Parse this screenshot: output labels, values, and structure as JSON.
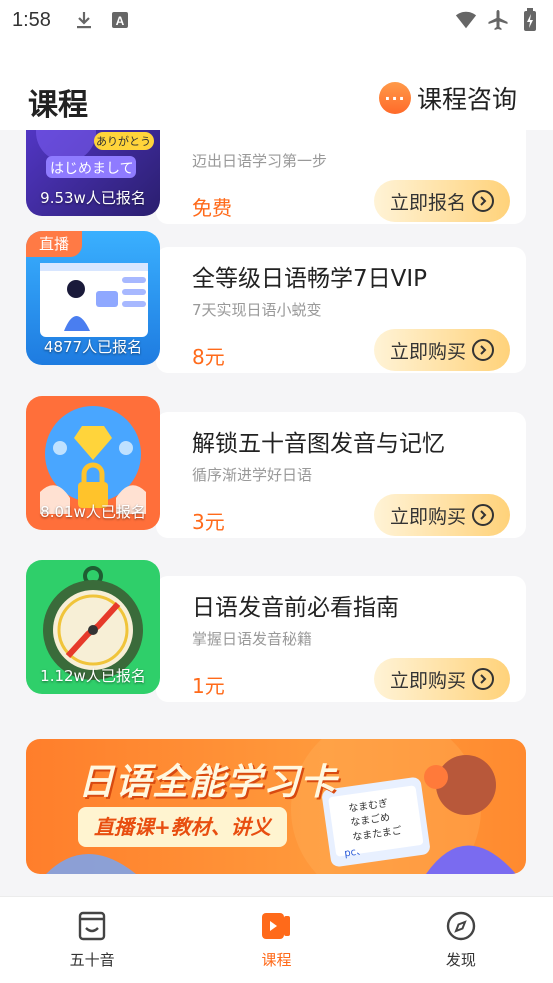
{
  "status_bar": {
    "time": "1:58",
    "left_icons": [
      "download-icon",
      "a-letter-icon"
    ],
    "right_icons": [
      "wifi-icon",
      "airplane-icon",
      "battery-charging-icon"
    ]
  },
  "header": {
    "title": "课程",
    "consult_label": "课程咨询",
    "consult_icon": "chat-dots-icon"
  },
  "courses": [
    {
      "title": "",
      "subtitle": "迈出日语学习第一步",
      "price": "免费",
      "button_label": "立即报名",
      "thumb_count": "9.53w人已报名",
      "thumb_tag": "",
      "thumb_text_1": "ありがとう",
      "thumb_text_2": "はじめまして"
    },
    {
      "title": "全等级日语畅学7日VIP",
      "subtitle": "7天实现日语小蜕变",
      "price": "8元",
      "button_label": "立即购买",
      "thumb_count": "4877人已报名",
      "thumb_tag": "直播"
    },
    {
      "title": "解锁五十音图发音与记忆",
      "subtitle": "循序渐进学好日语",
      "price": "3元",
      "button_label": "立即购买",
      "thumb_count": "8.01w人已报名",
      "thumb_tag": ""
    },
    {
      "title": "日语发音前必看指南",
      "subtitle": "掌握日语发音秘籍",
      "price": "1元",
      "button_label": "立即购买",
      "thumb_count": "1.12w人已报名",
      "thumb_tag": ""
    }
  ],
  "banner": {
    "title": "日语全能学习卡",
    "subtitle": "直播课+教材、讲义",
    "card_text_1": "なまむぎ",
    "card_text_2": "なまごめ",
    "card_text_3": "なまたまご",
    "card_text_4": "pc、"
  },
  "bottom_nav": {
    "items": [
      {
        "label": "五十音",
        "icon": "book-icon",
        "active": false
      },
      {
        "label": "课程",
        "icon": "play-icon",
        "active": true
      },
      {
        "label": "发现",
        "icon": "compass-icon",
        "active": false
      }
    ]
  },
  "colors": {
    "accent": "#ff6a1a",
    "button_gradient_start": "#fff3d6",
    "button_gradient_end": "#ffd27a",
    "page_bg": "#f5f5f7"
  }
}
